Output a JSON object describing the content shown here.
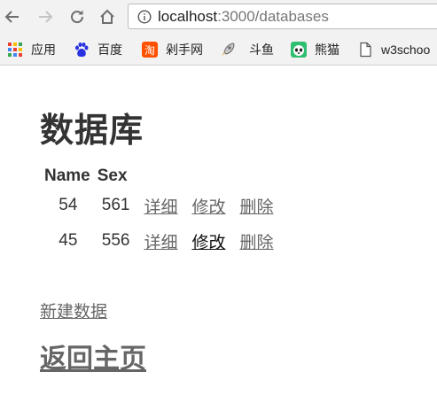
{
  "browser": {
    "url_host": "localhost",
    "url_path": ":3000/databases",
    "bookmarks": [
      {
        "label": "应用",
        "icon": "apps-grid-icon"
      },
      {
        "label": "百度",
        "icon": "baidu-paw-icon"
      },
      {
        "label": "剁手网",
        "icon": "taobao-icon"
      },
      {
        "label": "",
        "icon": "rocket-icon"
      },
      {
        "label": "斗鱼",
        "icon": "douyu-icon"
      },
      {
        "label": "熊猫",
        "icon": "panda-icon"
      },
      {
        "label": "w3schoo",
        "icon": "page-icon"
      }
    ]
  },
  "page": {
    "title": "数据库",
    "table": {
      "headers": [
        "Name",
        "Sex"
      ],
      "rows": [
        {
          "name": "54",
          "sex": "561",
          "detail": "详细",
          "edit": "修改",
          "delete": "删除"
        },
        {
          "name": "45",
          "sex": "556",
          "detail": "详细",
          "edit": "修改",
          "delete": "删除"
        }
      ]
    },
    "new_link": "新建数据",
    "home_link": "返回主页"
  }
}
